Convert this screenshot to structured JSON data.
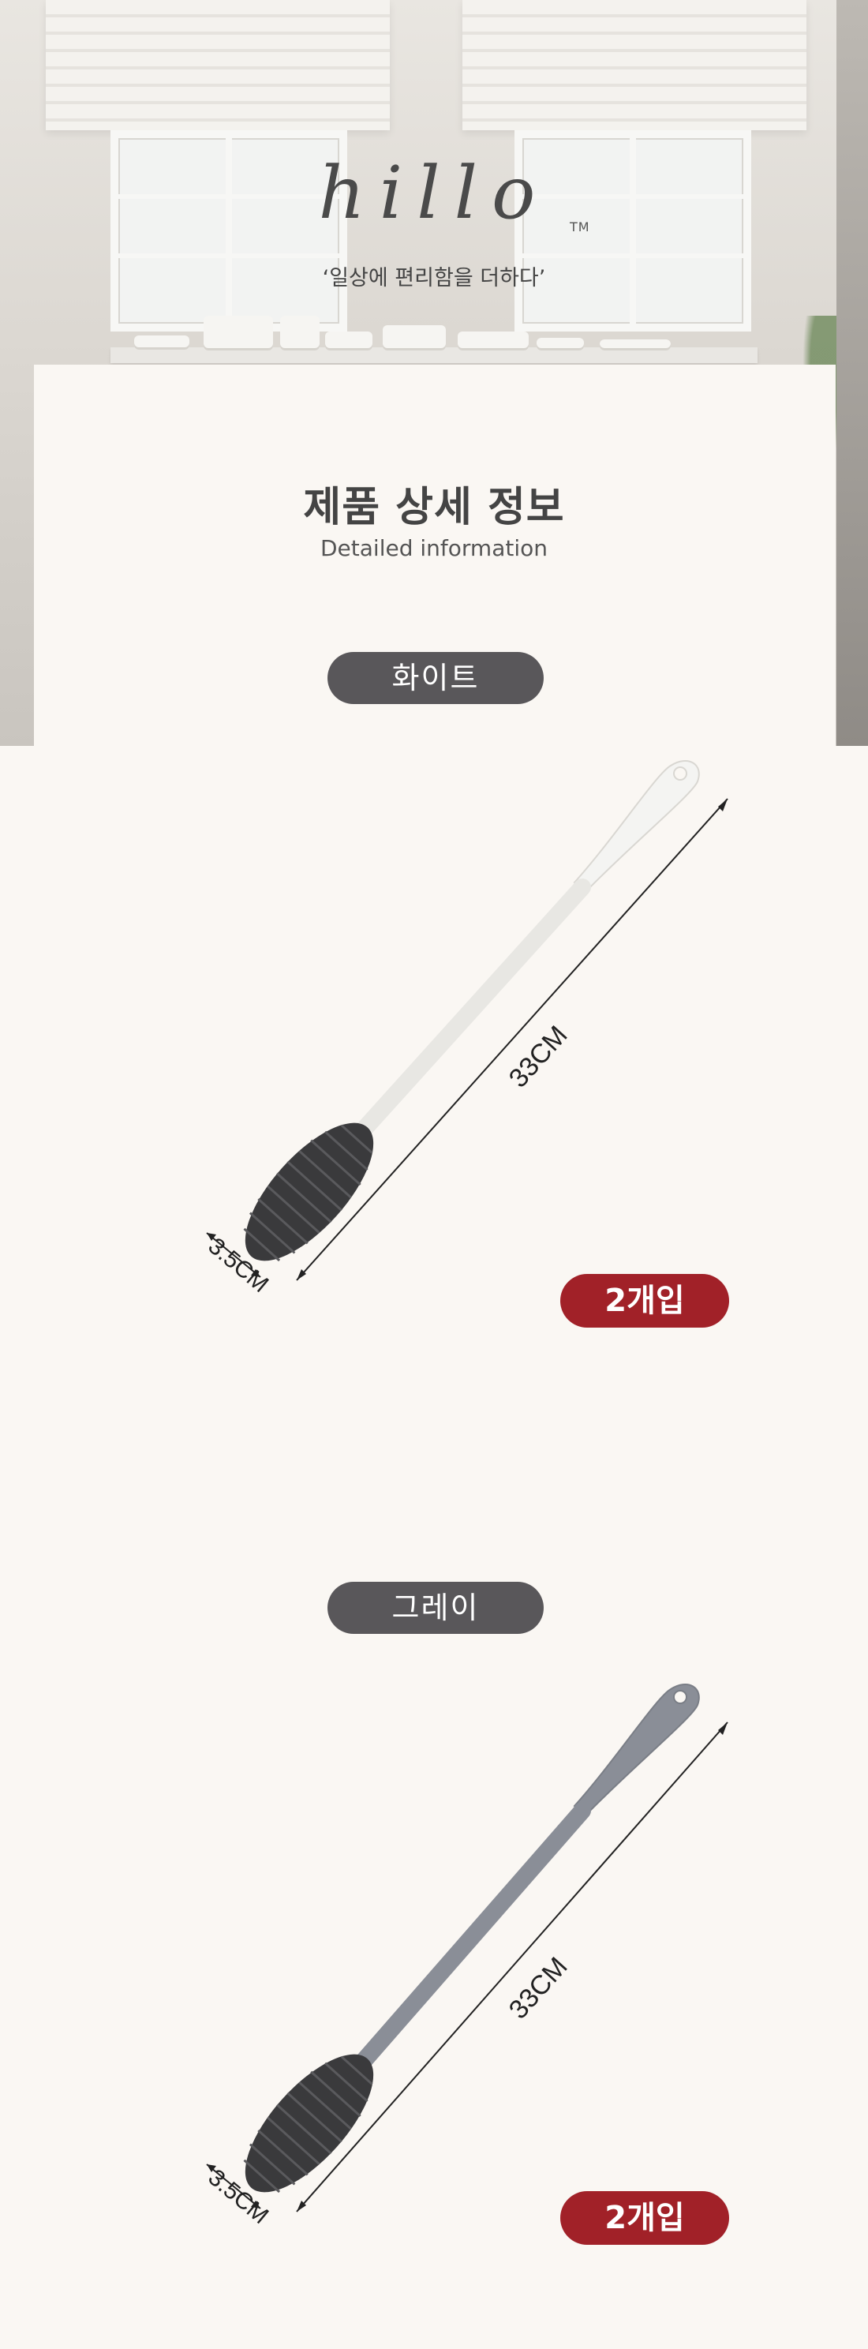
{
  "brand": {
    "logo": "hillo",
    "trademark": "TM",
    "slogan": "‘일상에 편리함을 더하다’"
  },
  "section": {
    "title": "제품 상세 정보",
    "subtitle": "Detailed information"
  },
  "products": [
    {
      "color_label": "화이트",
      "length_label": "33CM",
      "diameter_label": "3.5CM",
      "quantity_label": "2개입",
      "handle_color": "#f4f4f2",
      "bristle_color": "#3a3a3c"
    },
    {
      "color_label": "그레이",
      "length_label": "33CM",
      "diameter_label": "3.5CM",
      "quantity_label": "2개입",
      "handle_color": "#8a8e97",
      "bristle_color": "#3a3a3c"
    }
  ],
  "colors": {
    "pill_bg": "#59575a",
    "badge_bg": "#a12128",
    "panel_bg": "#faf7f3"
  }
}
